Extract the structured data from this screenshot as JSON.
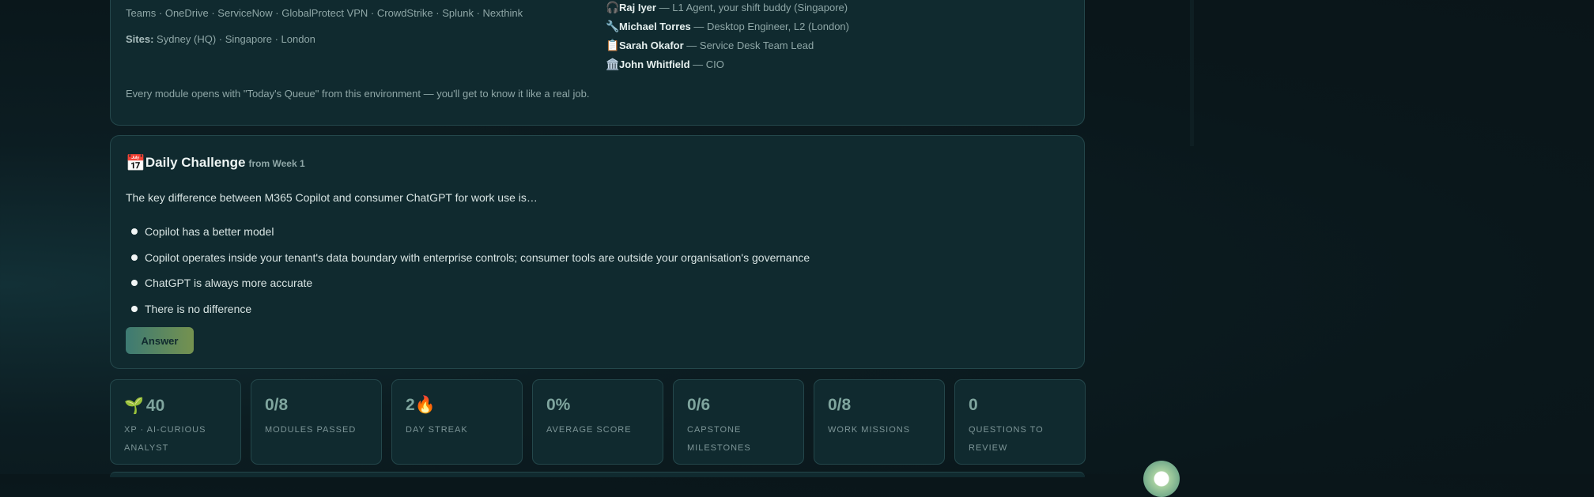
{
  "environment": {
    "tools": "Teams · OneDrive · ServiceNow · GlobalProtect VPN · CrowdStrike · Splunk · Nexthink",
    "sites_label": "Sites:",
    "sites": "Sydney (HQ) · Singapore · London",
    "note": "Every module opens with \"Today's Queue\" from this environment — you'll get to know it like a real job.",
    "people": [
      {
        "emoji": "🎧",
        "name": "Raj Iyer",
        "role": "— L1 Agent, your shift buddy (Singapore)"
      },
      {
        "emoji": "🔧",
        "name": "Michael Torres",
        "role": "— Desktop Engineer, L2 (London)"
      },
      {
        "emoji": "📋",
        "name": "Sarah Okafor",
        "role": "— Service Desk Team Lead"
      },
      {
        "emoji": "🏛️",
        "name": "John Whitfield",
        "role": "— CIO"
      }
    ]
  },
  "challenge": {
    "emoji": "📅",
    "title": "Daily Challenge",
    "week": "from Week 1",
    "question": "The key difference between M365 Copilot and consumer ChatGPT for work use is…",
    "options": [
      "Copilot has a better model",
      "Copilot operates inside your tenant's data boundary with enterprise controls; consumer tools are outside your organisation's governance",
      "ChatGPT is always more accurate",
      "There is no difference"
    ],
    "answer_label": "Answer"
  },
  "stats": [
    {
      "icon": "🌱",
      "value": "40",
      "label": "XP · AI-CURIOUS ANALYST"
    },
    {
      "icon": "",
      "value": "0/8",
      "label": "MODULES PASSED"
    },
    {
      "icon": "",
      "value": "2🔥",
      "label": "DAY STREAK"
    },
    {
      "icon": "",
      "value": "0%",
      "label": "AVERAGE SCORE"
    },
    {
      "icon": "",
      "value": "0/6",
      "label": "CAPSTONE MILESTONES"
    },
    {
      "icon": "",
      "value": "0/8",
      "label": "WORK MISSIONS"
    },
    {
      "icon": "",
      "value": "0",
      "label": "QUESTIONS TO REVIEW"
    }
  ],
  "colors": {
    "accent": "#7fa59e",
    "panel": "#102a2f",
    "border": "#24474b"
  }
}
